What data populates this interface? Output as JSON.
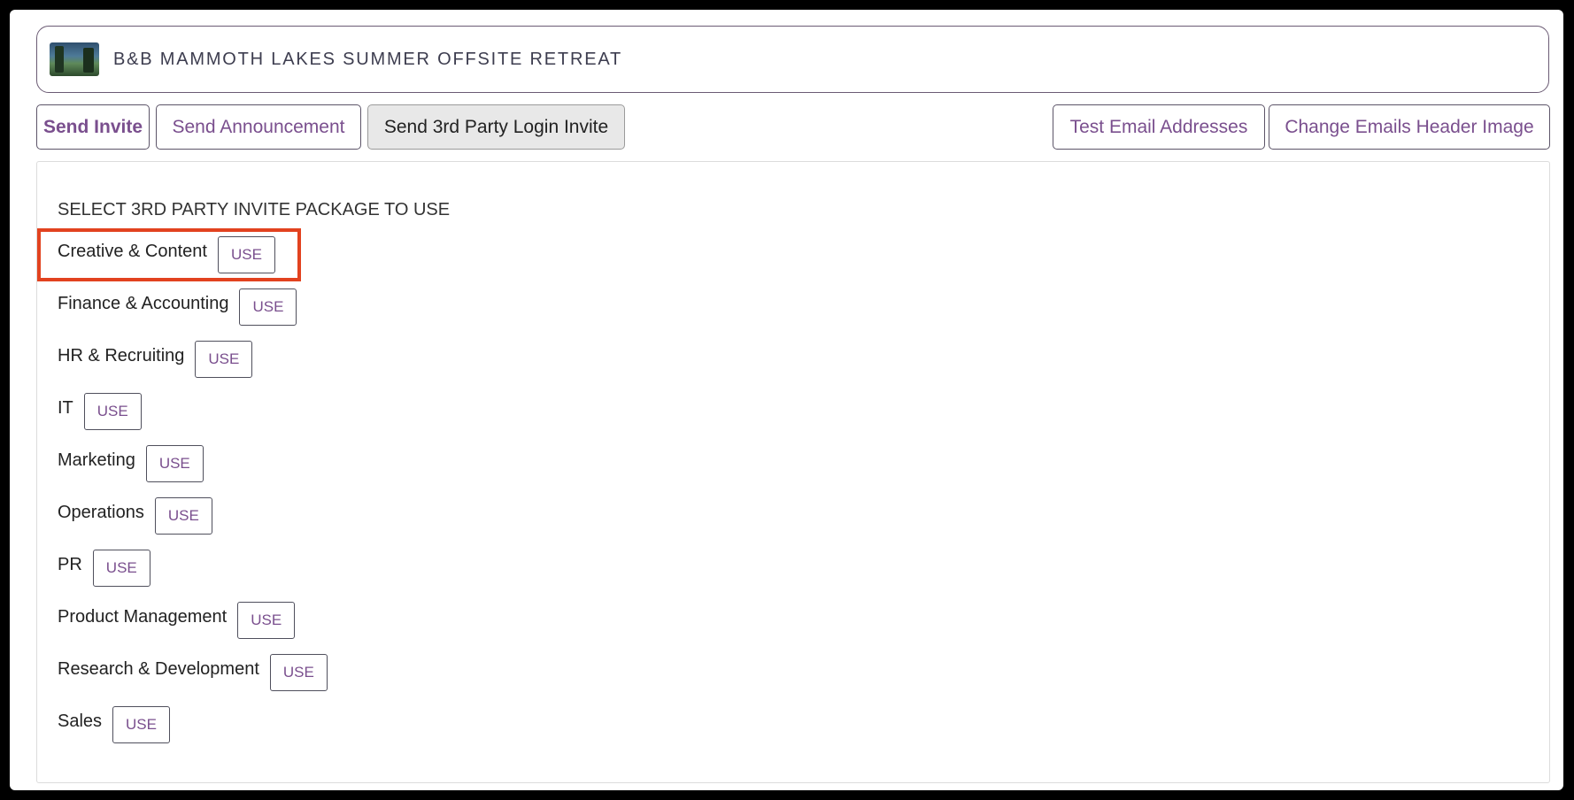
{
  "header": {
    "title": "B&B MAMMOTH LAKES SUMMER OFFSITE RETREAT"
  },
  "toolbar": {
    "send_invite": "Send Invite",
    "send_announcement": "Send Announcement",
    "send_3rd_party": "Send 3rd Party Login Invite",
    "test_email": "Test Email Addresses",
    "change_header": "Change Emails Header Image"
  },
  "panel": {
    "title": "SELECT 3RD PARTY INVITE PACKAGE TO USE",
    "use_label": "USE",
    "packages": [
      "Creative & Content",
      "Finance & Accounting",
      "HR & Recruiting",
      "IT",
      "Marketing",
      "Operations",
      "PR",
      "Product Management",
      "Research & Development",
      "Sales"
    ]
  },
  "colors": {
    "accent": "#7a4f8e",
    "highlight": "#e2421f"
  }
}
